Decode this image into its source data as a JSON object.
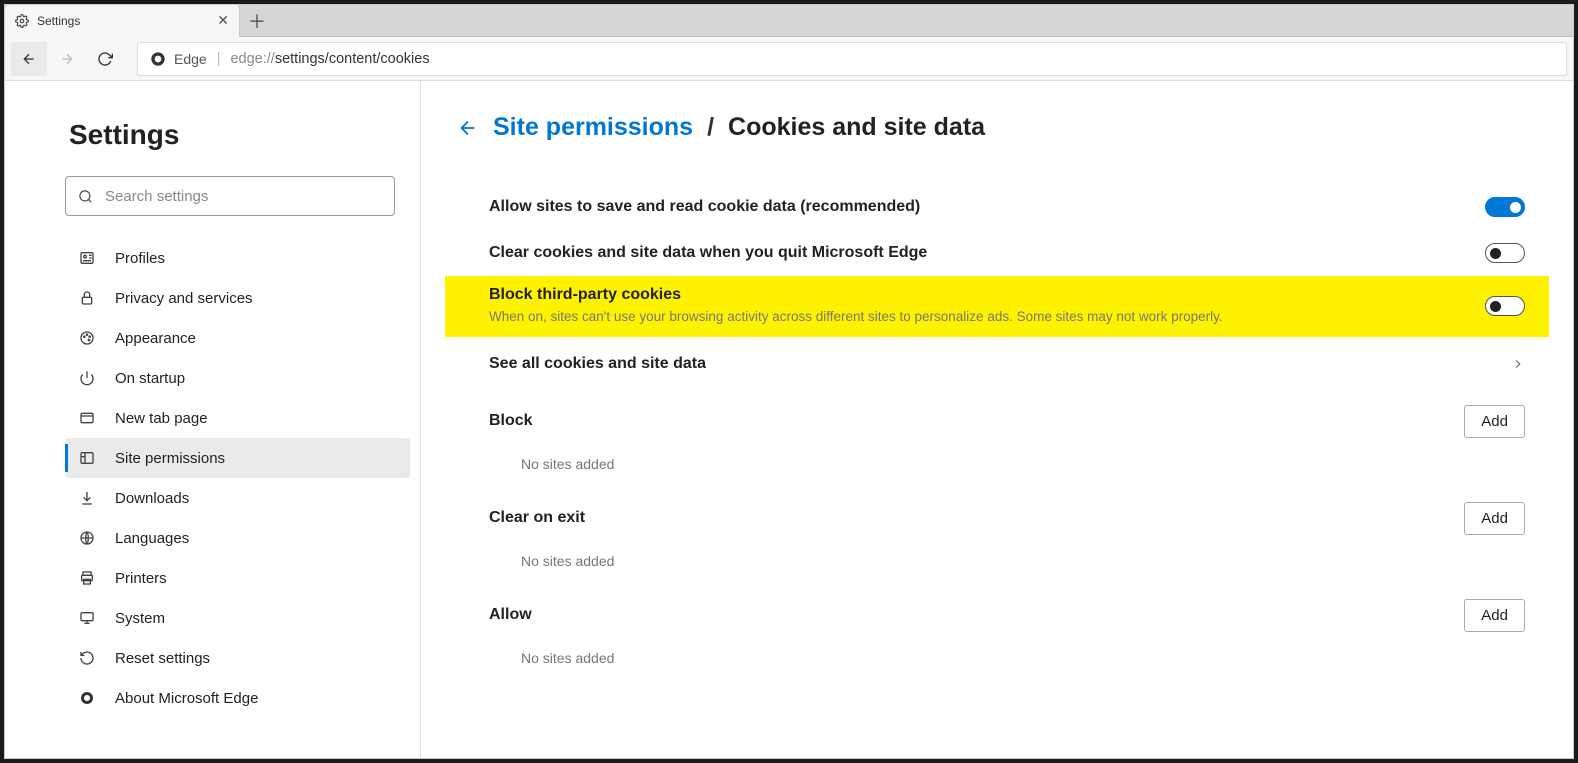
{
  "tab": {
    "title": "Settings"
  },
  "address": {
    "identity": "Edge",
    "prefix": "edge://",
    "rest": "settings/content/cookies"
  },
  "sidebar": {
    "heading": "Settings",
    "search_placeholder": "Search settings",
    "items": [
      {
        "label": "Profiles"
      },
      {
        "label": "Privacy and services"
      },
      {
        "label": "Appearance"
      },
      {
        "label": "On startup"
      },
      {
        "label": "New tab page"
      },
      {
        "label": "Site permissions"
      },
      {
        "label": "Downloads"
      },
      {
        "label": "Languages"
      },
      {
        "label": "Printers"
      },
      {
        "label": "System"
      },
      {
        "label": "Reset settings"
      },
      {
        "label": "About Microsoft Edge"
      }
    ]
  },
  "breadcrumb": {
    "parent": "Site permissions",
    "separator": "/",
    "current": "Cookies and site data"
  },
  "settings": {
    "allow_cookies": {
      "title": "Allow sites to save and read cookie data (recommended)",
      "on": true
    },
    "clear_on_quit": {
      "title": "Clear cookies and site data when you quit Microsoft Edge",
      "on": false
    },
    "block_third_party": {
      "title": "Block third-party cookies",
      "desc": "When on, sites can't use your browsing activity across different sites to personalize ads. Some sites may not work properly.",
      "on": false
    },
    "see_all": {
      "title": "See all cookies and site data"
    }
  },
  "sections": {
    "block": {
      "title": "Block",
      "add": "Add",
      "empty": "No sites added"
    },
    "clear_exit": {
      "title": "Clear on exit",
      "add": "Add",
      "empty": "No sites added"
    },
    "allow": {
      "title": "Allow",
      "add": "Add",
      "empty": "No sites added"
    }
  }
}
